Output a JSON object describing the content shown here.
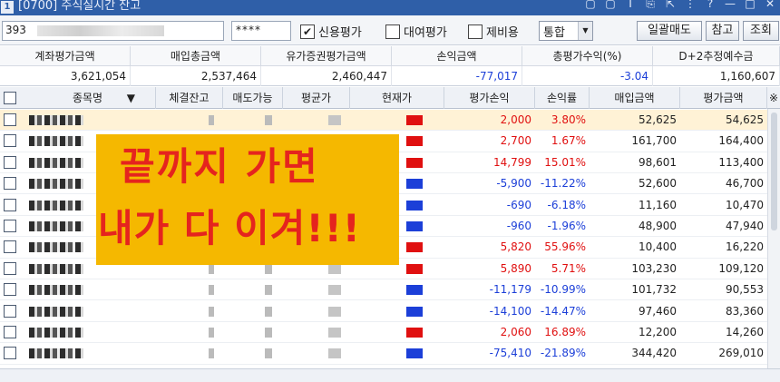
{
  "window": {
    "number": "1",
    "title": "[0700] 주식실시간 잔고",
    "controls": [
      "▢",
      "▢",
      "T",
      "⎘",
      "⇱",
      "⋮",
      "?",
      "—",
      "□",
      "✕"
    ]
  },
  "toolbar": {
    "account_prefix": "393",
    "password_mask": "****",
    "credit_eval": {
      "label": "신용평가",
      "checked": true
    },
    "lend_eval": {
      "label": "대여평가",
      "checked": false
    },
    "margin_use": {
      "label": "제비용",
      "checked": false
    },
    "mode_select": "통합",
    "sell_all_label": "일괄매도",
    "reference_label": "참고",
    "query_label": "조회"
  },
  "summary": {
    "headers": [
      "계좌평가금액",
      "매입총금액",
      "유가증권평가금액",
      "손익금액",
      "총평가수익(%)",
      "D+2추정예수금"
    ],
    "values": [
      "3,621,054",
      "2,537,464",
      "2,460,447",
      "-77,017",
      "-3.04",
      "1,160,607"
    ]
  },
  "grid": {
    "headers": [
      "종목명",
      "체결잔고",
      "매도가능",
      "평균가",
      "현재가",
      "평가손익",
      "손익률",
      "매입금액",
      "평가금액"
    ],
    "sort_indicator": "▼",
    "settings_icon": "※",
    "rows": [
      {
        "pnl": "2,000",
        "rate": "3.80%",
        "buy": "52,625",
        "eval": "54,625",
        "dir": "up"
      },
      {
        "pnl": "2,700",
        "rate": "1.67%",
        "buy": "161,700",
        "eval": "164,400",
        "dir": "up"
      },
      {
        "pnl": "14,799",
        "rate": "15.01%",
        "buy": "98,601",
        "eval": "113,400",
        "dir": "up"
      },
      {
        "pnl": "-5,900",
        "rate": "-11.22%",
        "buy": "52,600",
        "eval": "46,700",
        "dir": "down"
      },
      {
        "pnl": "-690",
        "rate": "-6.18%",
        "buy": "11,160",
        "eval": "10,470",
        "dir": "down"
      },
      {
        "pnl": "-960",
        "rate": "-1.96%",
        "buy": "48,900",
        "eval": "47,940",
        "dir": "down"
      },
      {
        "pnl": "5,820",
        "rate": "55.96%",
        "buy": "10,400",
        "eval": "16,220",
        "dir": "up"
      },
      {
        "pnl": "5,890",
        "rate": "5.71%",
        "buy": "103,230",
        "eval": "109,120",
        "dir": "up"
      },
      {
        "pnl": "-11,179",
        "rate": "-10.99%",
        "buy": "101,732",
        "eval": "90,553",
        "dir": "down"
      },
      {
        "pnl": "-14,100",
        "rate": "-14.47%",
        "buy": "97,460",
        "eval": "83,360",
        "dir": "down"
      },
      {
        "pnl": "2,060",
        "rate": "16.89%",
        "buy": "12,200",
        "eval": "14,260",
        "dir": "up"
      },
      {
        "pnl": "-75,410",
        "rate": "-21.89%",
        "buy": "344,420",
        "eval": "269,010",
        "dir": "down"
      }
    ]
  },
  "overlay": {
    "line1": "끝까지 가면",
    "line2": "내가 다 이겨!!!"
  },
  "colors": {
    "up": "#e01010",
    "down": "#1c3fd8",
    "highlight_row": "#fff2d6",
    "banner_bg": "#f5b800",
    "banner_text": "#e5241e",
    "titlebar": "#2f5fa8"
  }
}
